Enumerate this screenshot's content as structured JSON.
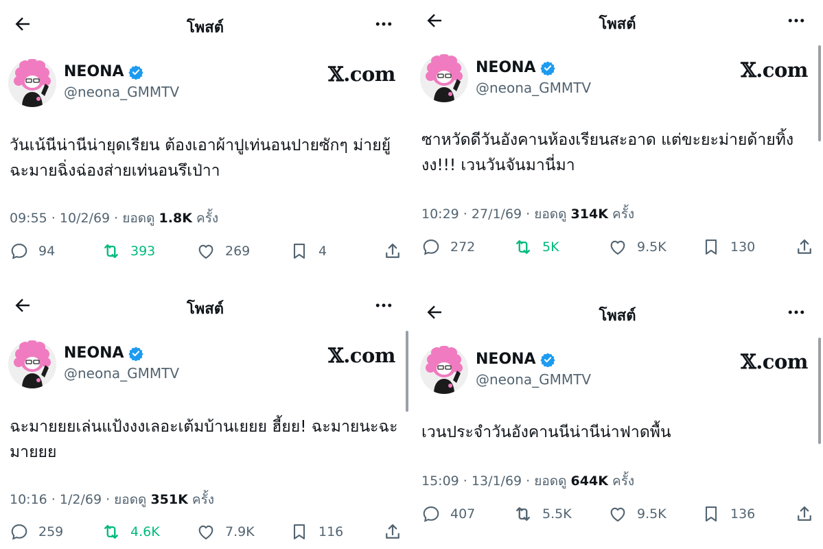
{
  "post_header_title": "โพสต์",
  "brand": "𝕏.com",
  "posts": [
    {
      "name": "NEONA",
      "handle": "@neona_GMMTV",
      "text": "วันเน้นีน่านีน่ายุดเรียน ต้องเอาผ้าปูเท่นอนปายซักๆ ม่ายยู้ฉะมายฉิ่งฉ่องส่ายเท่นอนรึเป่าา",
      "time": "09:55",
      "date": "10/2/69",
      "views_label": "ยอดดู",
      "views": "1.8K",
      "views_unit": "ครั้ง",
      "replies": "94",
      "reposts": "393",
      "likes": "269",
      "bookmarks": "4"
    },
    {
      "name": "NEONA",
      "handle": "@neona_GMMTV",
      "text": "ซาหวัดดีวันอังคานห้องเรียนสะอาด แต่ขะยะม่ายด้ายทิ้งงง!!! เวนวันจันมานี่มา",
      "time": "10:29",
      "date": "27/1/69",
      "views_label": "ยอดดู",
      "views": "314K",
      "views_unit": "ครั้ง",
      "replies": "272",
      "reposts": "5K",
      "likes": "9.5K",
      "bookmarks": "130"
    },
    {
      "name": "NEONA",
      "handle": "@neona_GMMTV",
      "text": "ฉะมายยยเล่นแป้งงงเลอะเต้มบ้านเยยย ฮี้ยย! ฉะมายนะฉะมายยย",
      "time": "10:16",
      "date": "1/2/69",
      "views_label": "ยอดดู",
      "views": "351K",
      "views_unit": "ครั้ง",
      "replies": "259",
      "reposts": "4.6K",
      "likes": "7.9K",
      "bookmarks": "116"
    },
    {
      "name": "NEONA",
      "handle": "@neona_GMMTV",
      "text": "เวนประจำวันอังคานนีน่านีน่าฟาดพื้น",
      "time": "15:09",
      "date": "13/1/69",
      "views_label": "ยอดดู",
      "views": "644K",
      "views_unit": "ครั้ง",
      "replies": "407",
      "reposts": "5.5K",
      "likes": "9.5K",
      "bookmarks": "136"
    }
  ],
  "colors": {
    "repost_active": "#00ba7c",
    "muted": "#536471",
    "verified": "#1d9bf0",
    "avatar_pink": "#f07bc0"
  }
}
